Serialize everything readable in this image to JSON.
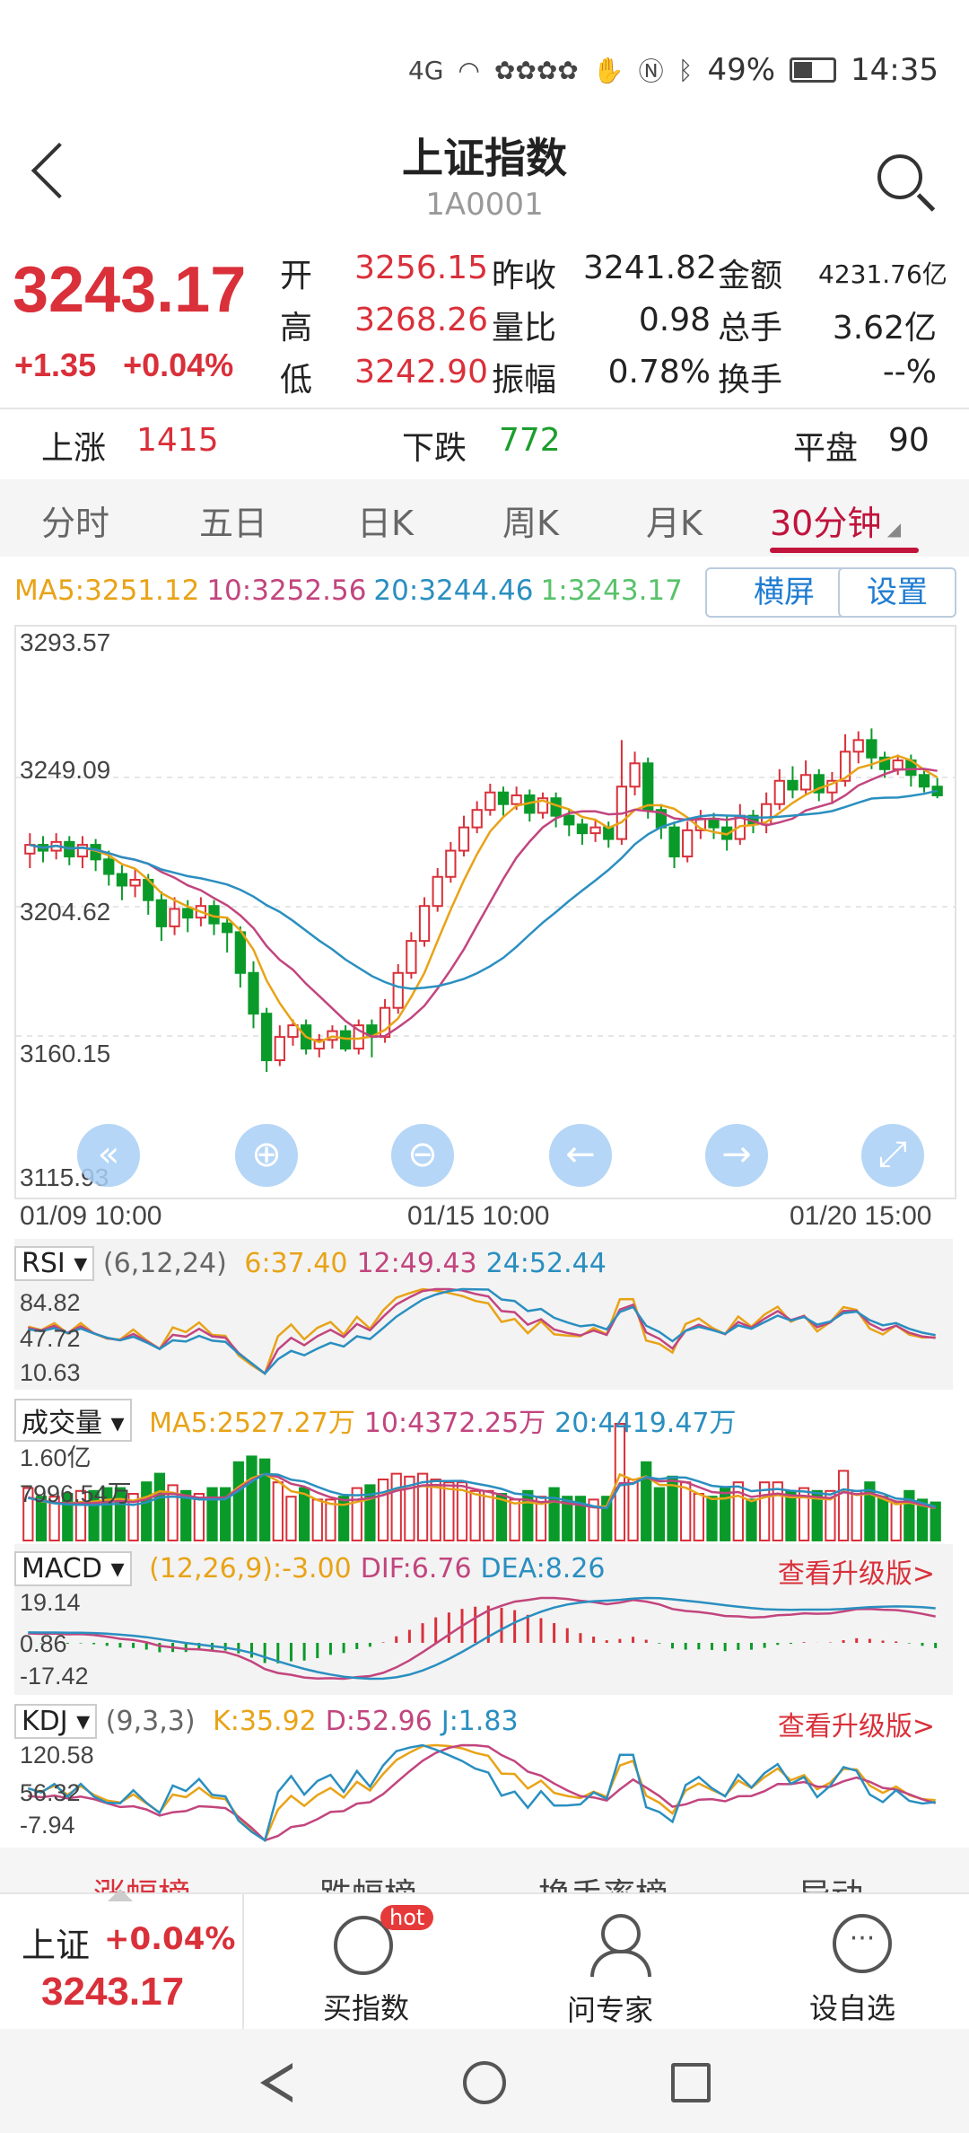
{
  "status": {
    "network": "4G",
    "battery": "49%",
    "time": "14:35"
  },
  "header": {
    "title": "上证指数",
    "code": "1A0001"
  },
  "quote": {
    "price": "3243.17",
    "change": "+1.35",
    "change_pct": "+0.04%",
    "rows": [
      [
        {
          "label": "开",
          "value": "3256.15",
          "color": "red"
        },
        {
          "label": "昨收",
          "value": "3241.82",
          "color": "black"
        },
        {
          "label": "金额",
          "value": "4231.76亿",
          "color": "black"
        }
      ],
      [
        {
          "label": "高",
          "value": "3268.26",
          "color": "red"
        },
        {
          "label": "量比",
          "value": "0.98",
          "color": "black"
        },
        {
          "label": "总手",
          "value": "3.62亿",
          "color": "black"
        }
      ],
      [
        {
          "label": "低",
          "value": "3242.90",
          "color": "red"
        },
        {
          "label": "振幅",
          "value": "0.78%",
          "color": "black"
        },
        {
          "label": "换手",
          "value": "--%",
          "color": "black"
        }
      ]
    ]
  },
  "counts": {
    "up_label": "上涨",
    "up_value": "1415",
    "down_label": "下跌",
    "down_value": "772",
    "flat_label": "平盘",
    "flat_value": "90"
  },
  "tabs": [
    "分时",
    "五日",
    "日K",
    "周K",
    "月K",
    "30分钟"
  ],
  "active_tab": 5,
  "ma_legend": [
    {
      "text": "MA5:3251.12",
      "color": "#e8a317"
    },
    {
      "text": "10:3252.56",
      "color": "#c2457e"
    },
    {
      "text": "20:3244.46",
      "color": "#2a8fc0"
    },
    {
      "text": "1:3243.17",
      "color": "#58c26b"
    }
  ],
  "buttons": {
    "landscape": "横屏",
    "settings": "设置"
  },
  "chart_data": {
    "type": "candlestick",
    "y_labels": [
      "3293.57",
      "3249.09",
      "3204.62",
      "3160.15",
      "3115.93"
    ],
    "ylim": [
      3115.93,
      3293.57
    ],
    "x_labels": [
      "01/09 10:00",
      "01/15 10:00",
      "01/20 15:00"
    ],
    "candles": [
      [
        3223,
        3226,
        3218,
        3230
      ],
      [
        3226,
        3224,
        3220,
        3229
      ],
      [
        3224,
        3227,
        3221,
        3230
      ],
      [
        3227,
        3222,
        3219,
        3229
      ],
      [
        3222,
        3226,
        3218,
        3229
      ],
      [
        3226,
        3221,
        3217,
        3228
      ],
      [
        3221,
        3216,
        3212,
        3224
      ],
      [
        3216,
        3212,
        3207,
        3219
      ],
      [
        3212,
        3214,
        3208,
        3218
      ],
      [
        3214,
        3207,
        3202,
        3216
      ],
      [
        3207,
        3198,
        3193,
        3210
      ],
      [
        3198,
        3204,
        3195,
        3208
      ],
      [
        3204,
        3201,
        3196,
        3207
      ],
      [
        3201,
        3205,
        3198,
        3208
      ],
      [
        3205,
        3199,
        3195,
        3207
      ],
      [
        3199,
        3196,
        3189,
        3201
      ],
      [
        3196,
        3182,
        3177,
        3198
      ],
      [
        3182,
        3168,
        3163,
        3186
      ],
      [
        3168,
        3152,
        3148,
        3170
      ],
      [
        3152,
        3160,
        3150,
        3164
      ],
      [
        3160,
        3164,
        3157,
        3166
      ],
      [
        3164,
        3156,
        3154,
        3166
      ],
      [
        3156,
        3159,
        3153,
        3161
      ],
      [
        3159,
        3162,
        3156,
        3164
      ],
      [
        3162,
        3156,
        3155,
        3164
      ],
      [
        3156,
        3164,
        3154,
        3166
      ],
      [
        3164,
        3160,
        3153,
        3166
      ],
      [
        3160,
        3170,
        3158,
        3173
      ],
      [
        3170,
        3182,
        3168,
        3185
      ],
      [
        3182,
        3193,
        3180,
        3196
      ],
      [
        3193,
        3205,
        3191,
        3208
      ],
      [
        3205,
        3215,
        3203,
        3218
      ],
      [
        3215,
        3224,
        3213,
        3227
      ],
      [
        3224,
        3232,
        3222,
        3236
      ],
      [
        3232,
        3238,
        3230,
        3241
      ],
      [
        3238,
        3244,
        3236,
        3247
      ],
      [
        3244,
        3240,
        3236,
        3246
      ],
      [
        3240,
        3243,
        3238,
        3246
      ],
      [
        3243,
        3237,
        3234,
        3245
      ],
      [
        3237,
        3242,
        3235,
        3244
      ],
      [
        3242,
        3236,
        3232,
        3244
      ],
      [
        3236,
        3233,
        3229,
        3238
      ],
      [
        3233,
        3230,
        3226,
        3235
      ],
      [
        3230,
        3232,
        3227,
        3235
      ],
      [
        3232,
        3228,
        3225,
        3234
      ],
      [
        3228,
        3246,
        3226,
        3262
      ],
      [
        3246,
        3254,
        3243,
        3258
      ],
      [
        3254,
        3238,
        3235,
        3256
      ],
      [
        3238,
        3232,
        3228,
        3240
      ],
      [
        3232,
        3222,
        3218,
        3234
      ],
      [
        3222,
        3231,
        3220,
        3234
      ],
      [
        3231,
        3235,
        3228,
        3238
      ],
      [
        3235,
        3232,
        3228,
        3237
      ],
      [
        3232,
        3228,
        3224,
        3236
      ],
      [
        3228,
        3236,
        3226,
        3240
      ],
      [
        3236,
        3233,
        3230,
        3238
      ],
      [
        3233,
        3240,
        3230,
        3244
      ],
      [
        3240,
        3248,
        3238,
        3252
      ],
      [
        3248,
        3245,
        3242,
        3253
      ],
      [
        3245,
        3250,
        3243,
        3255
      ],
      [
        3250,
        3244,
        3241,
        3252
      ],
      [
        3244,
        3248,
        3240,
        3251
      ],
      [
        3248,
        3258,
        3246,
        3264
      ],
      [
        3258,
        3262,
        3254,
        3265
      ],
      [
        3262,
        3256,
        3252,
        3266
      ],
      [
        3256,
        3252,
        3249,
        3258
      ],
      [
        3252,
        3255,
        3250,
        3257
      ],
      [
        3255,
        3250,
        3246,
        3257
      ],
      [
        3250,
        3246,
        3244,
        3252
      ],
      [
        3246,
        3243,
        3242,
        3249
      ]
    ]
  },
  "rsi": {
    "label": "RSI",
    "params": "(6,12,24)",
    "values": [
      {
        "text": "6:37.40",
        "color": "#e8a317"
      },
      {
        "text": "12:49.43",
        "color": "#c2457e"
      },
      {
        "text": "24:52.44",
        "color": "#2a8fc0"
      }
    ],
    "y_labels": [
      "84.82",
      "47.72",
      "10.63"
    ]
  },
  "volume": {
    "label": "成交量",
    "values": [
      {
        "text": "MA5:2527.27万",
        "color": "#e8a317"
      },
      {
        "text": "10:4372.25万",
        "color": "#c2457e"
      },
      {
        "text": "20:4419.47万",
        "color": "#2a8fc0"
      }
    ],
    "y_labels": [
      "1.60亿",
      "7996.54万"
    ]
  },
  "macd": {
    "label": "MACD",
    "values": [
      {
        "text": "(12,26,9):-3.00",
        "color": "#e8a317"
      },
      {
        "text": "DIF:6.76",
        "color": "#c2457e"
      },
      {
        "text": "DEA:8.26",
        "color": "#2a8fc0"
      }
    ],
    "y_labels": [
      "19.14",
      "0.86",
      "-17.42"
    ],
    "upgrade": "查看升级版>"
  },
  "kdj": {
    "label": "KDJ",
    "params": "(9,3,3)",
    "values": [
      {
        "text": "K:35.92",
        "color": "#e8a317"
      },
      {
        "text": "D:52.96",
        "color": "#c2457e"
      },
      {
        "text": "J:1.83",
        "color": "#2a8fc0"
      }
    ],
    "y_labels": [
      "120.58",
      "56.32",
      "-7.94"
    ],
    "upgrade": "查看升级版>"
  },
  "hidden_tabs": [
    "涨幅榜",
    "跌幅榜",
    "换手率榜",
    "异动"
  ],
  "bottom": {
    "index_name": "上证",
    "index_change": "+0.04%",
    "index_price": "3243.17",
    "buy_label": "买指数",
    "hot_badge": "hot",
    "ask_label": "问专家",
    "watch_label": "设自选"
  }
}
